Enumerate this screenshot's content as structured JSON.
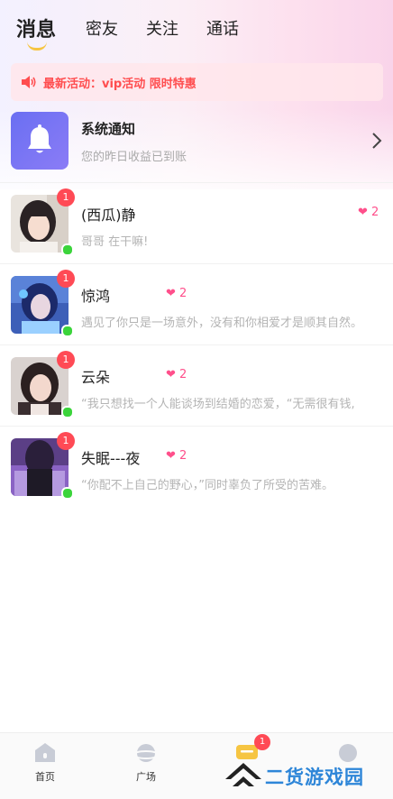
{
  "tabs": [
    {
      "label": "消息",
      "active": true
    },
    {
      "label": "密友",
      "active": false
    },
    {
      "label": "关注",
      "active": false
    },
    {
      "label": "通话",
      "active": false
    }
  ],
  "banner": {
    "text": "最新活动：vip活动 限时特惠",
    "icon": "speaker-icon"
  },
  "system": {
    "title": "系统通知",
    "subtitle": "您的昨日收益已到账",
    "icon": "bell-icon"
  },
  "conversations": [
    {
      "name": "(西瓜)静",
      "message": "哥哥 在干嘛!",
      "unread": "1",
      "hearts": "2",
      "online": true
    },
    {
      "name": "惊鸿",
      "message": "遇见了你只是一场意外，没有和你相爱才是顺其自然。",
      "unread": "1",
      "hearts": "2",
      "online": true
    },
    {
      "name": "云朵",
      "message": "“我只想找一个人能谈场到结婚的恋爱，“无需很有钱,",
      "unread": "1",
      "hearts": "2",
      "online": true
    },
    {
      "name": "失眠---夜",
      "message": "“你配不上自己的野心，”同时辜负了所受的苦难。",
      "unread": "1",
      "hearts": "2",
      "online": true
    }
  ],
  "tabbar": {
    "items": [
      {
        "label": "首页",
        "icon": "home-icon"
      },
      {
        "label": "广场",
        "icon": "planet-icon"
      },
      {
        "label": "",
        "icon": "message-icon"
      },
      {
        "label": "",
        "icon": "profile-icon"
      }
    ],
    "message_badge": "1"
  },
  "watermark": {
    "text": "二货游戏园"
  },
  "colors": {
    "accent_red": "#ff4a55",
    "heart": "#ff4f8b",
    "online": "#3bd43b",
    "tab_underline": "#f6c542"
  }
}
